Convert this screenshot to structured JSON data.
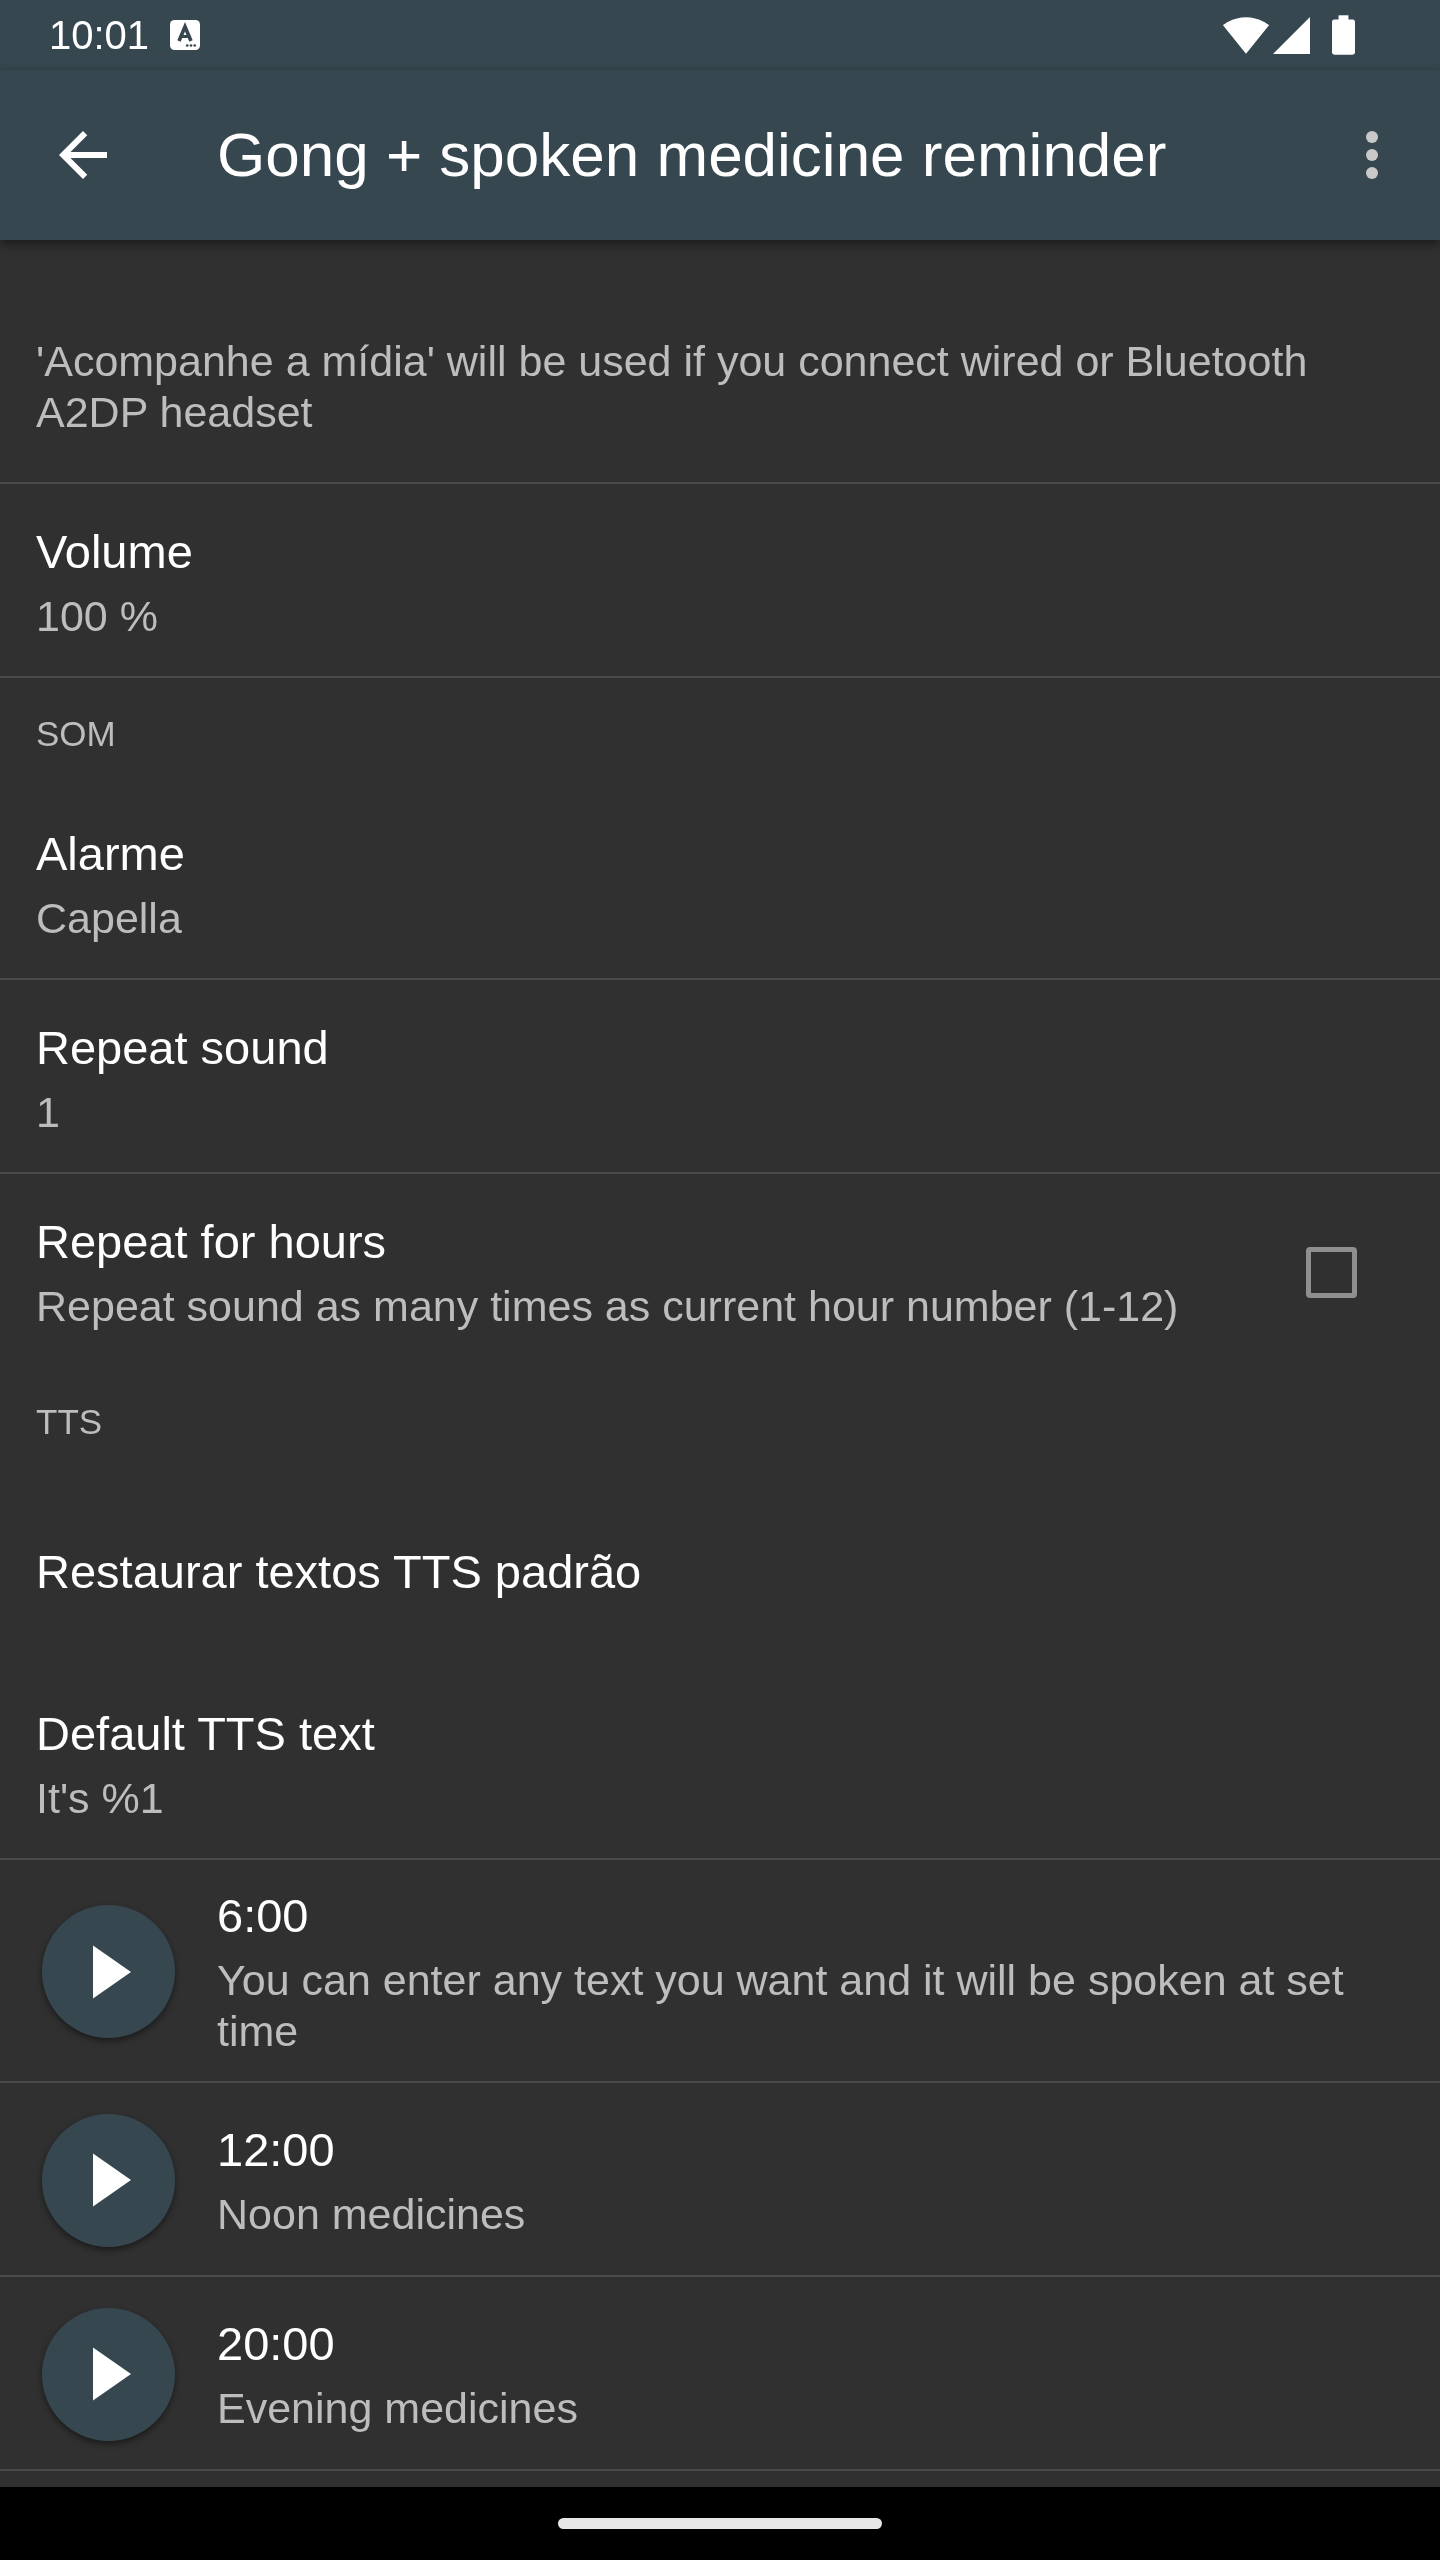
{
  "status_bar": {
    "time": "10:01"
  },
  "app_bar": {
    "title": "Gong + spoken medicine reminder"
  },
  "settings": [
    {
      "kind": "note",
      "text": "'Acompanhe a mídia' will be used if you connect wired or Bluetooth A2DP headset",
      "divider": true
    },
    {
      "kind": "preference",
      "title": "Volume",
      "summary": "100 %",
      "divider": true
    },
    {
      "kind": "category",
      "title": "SOM",
      "divider": false
    },
    {
      "kind": "preference",
      "title": "Alarme",
      "summary": "Capella",
      "divider": true
    },
    {
      "kind": "preference",
      "title": "Repeat sound",
      "summary": "1",
      "divider": true
    },
    {
      "kind": "checkbox",
      "title": "Repeat for hours",
      "summary": "Repeat sound as many times as current hour number (1-12)",
      "checked": false,
      "divider": false
    },
    {
      "kind": "category",
      "title": "TTS",
      "divider": false
    },
    {
      "kind": "preference",
      "title": "Restaurar textos TTS padrão",
      "divider": false
    },
    {
      "kind": "preference",
      "title": "Default TTS text",
      "summary": "It's %1",
      "divider": true
    }
  ],
  "spoken_texts": [
    {
      "time": "6:00",
      "text": "You can enter any text you want and it will be spoken at set time"
    },
    {
      "time": "12:00",
      "text": "Noon medicines"
    },
    {
      "time": "20:00",
      "text": "Evening medicines"
    }
  ]
}
